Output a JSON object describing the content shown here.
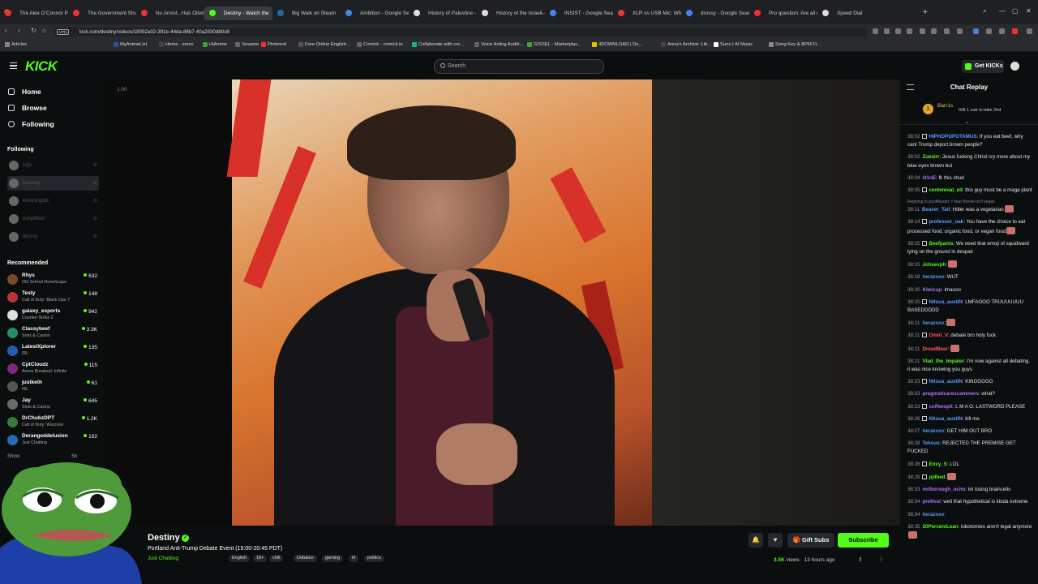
{
  "browser": {
    "tabs": [
      {
        "label": "The Alex O'Connor Podca",
        "color": "#e33"
      },
      {
        "label": "The Government Shutdo",
        "color": "#e33"
      },
      {
        "label": "No Arrest...Has Olivd Bee",
        "color": "#e33"
      },
      {
        "label": "Destiny - Watch the",
        "color": "#53fc18",
        "active": true
      },
      {
        "label": "Big Walk on Steam",
        "color": "#1b6bb3"
      },
      {
        "label": "Ambition - Google Search",
        "color": "#4285f4"
      },
      {
        "label": "History of Palestine - Wik",
        "color": "#ddd"
      },
      {
        "label": "History of the Israeli–Pale",
        "color": "#ddd"
      },
      {
        "label": "INSIST - Google Search",
        "color": "#4285f4"
      },
      {
        "label": "XLR vs USB Mic: Which Sh",
        "color": "#e33"
      },
      {
        "label": "drossy - Google Search",
        "color": "#4285f4"
      },
      {
        "label": "Pro question: Are all mic",
        "color": "#e33"
      },
      {
        "label": "Speed Dial",
        "color": "#ddd"
      }
    ],
    "url": "kick.com/destiny/videos/18092a02-391e-44da-88b7-40a2930d80c8",
    "vpn": "VPN",
    "bookmarks": [
      "Articles",
      "MyAnimeList",
      "Home - zmov",
      "HiAnime",
      "Sesame",
      "Pinterest",
      "Free Online English...",
      "Comick - comick.io",
      "Collaborate with cre...",
      "Voice Acting Auditi...",
      "GISSEL - Marketplac...",
      "4DOWNLOAD | Do...",
      "Anna's Archive: Lib...",
      "Suno | AI Music",
      "Song Key & BPM Fi..."
    ]
  },
  "header": {
    "logo": "KICK",
    "search_placeholder": "Search",
    "get_kicks": "Get KICKs"
  },
  "sidebar": {
    "nav": [
      "Home",
      "Browse",
      "Following"
    ],
    "following_title": "Following",
    "following": [
      "xQc",
      "Destiny",
      "esmongold",
      "Amplified",
      "feussy"
    ],
    "recommended_title": "Recommended",
    "recommended": [
      {
        "name": "Rhys",
        "category": "Old School RuneScape",
        "viewers": "632",
        "color": "#7a4b2a"
      },
      {
        "name": "Testy",
        "category": "Call of Duty: Black Ops 7",
        "viewers": "148",
        "color": "#b33"
      },
      {
        "name": "galaxy_esports",
        "category": "Counter-Strike 2",
        "viewers": "942",
        "color": "#ddd"
      },
      {
        "name": "Classybeef",
        "category": "Slots & Casino",
        "viewers": "3.3K",
        "color": "#2a8a6a"
      },
      {
        "name": "LatestXplorer",
        "category": "IRL",
        "viewers": "135",
        "color": "#2a5ab3"
      },
      {
        "name": "CptCloudz",
        "category": "Arena Breakout: Infinite",
        "viewers": "115",
        "color": "#7a2a7a"
      },
      {
        "name": "justketh",
        "category": "IRL",
        "viewers": "61",
        "color": "#555"
      },
      {
        "name": "Jay",
        "category": "Slots & Casino",
        "viewers": "645",
        "color": "#6a6a6a"
      },
      {
        "name": "DrChubzDPT",
        "category": "Call of Duty: Warzone",
        "viewers": "1.2K",
        "color": "#3a7a3a"
      },
      {
        "name": "Derangeddelusion",
        "category": "Just Chatting",
        "viewers": "102",
        "color": "#2a6ab3"
      }
    ],
    "show_more": "Show",
    "show_less": "Sh"
  },
  "video": {
    "timecode": "1.00"
  },
  "stream": {
    "channel": "Destiny",
    "title": "Portland Anti-Trump Debate Event (19:00-20:45 PDT)",
    "category": "Just Chatting",
    "tags": [
      "English",
      "18+",
      "chill",
      "Debates",
      "gaming",
      "irl",
      "politics"
    ],
    "views": "3.5K",
    "views_suffix": "views",
    "age": "13 hours ago",
    "gift_label": "Gift Subs",
    "subscribe_label": "Subscribe"
  },
  "chat": {
    "title": "Chat Replay",
    "pinned_rank": "1",
    "pinned_user": "Barr1s",
    "pinned_text": "Gift 1 sub to take 2nd",
    "messages": [
      {
        "ts": "38:02",
        "user": "HIPHOPOPOTAMUS",
        "color": "#5a9cff",
        "badge": true,
        "text": ": If you eat beef, why cant Trump deport brown people?"
      },
      {
        "ts": "38:02",
        "user": "Zuesirr",
        "color": "#53fc18",
        "text": ": Jesus fucking Christ cry more about my blue eyes brown boi"
      },
      {
        "ts": "38:04",
        "user": "l41nE",
        "color": "#b070ff",
        "text": ": fk this chud"
      },
      {
        "ts": "38:05",
        "user": "centennial_oil",
        "color": "#53fc18",
        "badge": true,
        "text": ": this guy must be a maga plant"
      },
      {
        "ts": "38:11",
        "user": "Beaver_Tail",
        "color": "#5a9cff",
        "reply": "Replying to puntMaster: I hear Bernie isn't vegan",
        "text": ": Hitler was a vegetarian",
        "emote": true
      },
      {
        "ts": "38:14",
        "user": "professor_oak",
        "color": "#5a9cff",
        "badge": true,
        "text": ": You have the choice to eat processed food, organic food, or vegan food",
        "emote": true
      },
      {
        "ts": "38:15",
        "user": "Beefpants",
        "color": "#53fc18",
        "badge": true,
        "text": ": We need that emoji of squidward lying on the ground in despair"
      },
      {
        "ts": "38:15",
        "user": "Johsevph",
        "color": "#53fc18",
        "text": ":",
        "emote": true
      },
      {
        "ts": "38:18",
        "user": "herazosv",
        "color": "#5a9cff",
        "text": ": WUT"
      },
      {
        "ts": "38:20",
        "user": "Kiwicup",
        "color": "#b070ff",
        "text": ": lmaooo"
      },
      {
        "ts": "38:20",
        "user": "Nitsua_austiN",
        "color": "#5a9cff",
        "badge": true,
        "text": ": LMFAOOO TRUUUUUUU BASEDDDDD"
      },
      {
        "ts": "38:21",
        "user": "herazosv",
        "color": "#5a9cff",
        "text": ":",
        "emote": true
      },
      {
        "ts": "38:21",
        "user": "Omni_V",
        "color": "#ff5a5a",
        "badge": true,
        "text": ": debate bro holy fuck"
      },
      {
        "ts": "38:21",
        "user": "DreadBear",
        "color": "#ff5a5a",
        "text": ":",
        "emote": true
      },
      {
        "ts": "38:21",
        "user": "Vlad_the_Impaler",
        "color": "#53fc18",
        "text": ": I'm now against all debating. it was nice knowing you guys"
      },
      {
        "ts": "38:23",
        "user": "Nitsua_austiN",
        "color": "#5a9cff",
        "badge": true,
        "text": ": KINGGGGG"
      },
      {
        "ts": "38:23",
        "user": "pragmaticarescammers",
        "color": "#b070ff",
        "text": ": what?"
      },
      {
        "ts": "38:23",
        "user": "coffeespit",
        "color": "#b070ff",
        "badge": true,
        "text": ": L M A O. LASTWORD PLEASE"
      },
      {
        "ts": "38:26",
        "user": "Nitsua_austiN",
        "color": "#5a9cff",
        "badge": true,
        "text": ": kill me"
      },
      {
        "ts": "38:27",
        "user": "herazosv",
        "color": "#5a9cff",
        "text": ": GET HIM OUT BRO"
      },
      {
        "ts": "38:28",
        "user": "Teksuo",
        "color": "#5a9cff",
        "text": ": REJECTED THE PREMISE GET FUCKED"
      },
      {
        "ts": "38:28",
        "user": "Envy_S",
        "color": "#53fc18",
        "badge": true,
        "text": ": LOL"
      },
      {
        "ts": "38:29",
        "user": "pj4hed",
        "color": "#53fc18",
        "badge": true,
        "text": ":",
        "emote": true
      },
      {
        "ts": "38:33",
        "user": "mrlborough_ocho",
        "color": "#b070ff",
        "text": ": im losing braincells"
      },
      {
        "ts": "38:34",
        "user": "prefixui",
        "color": "#b070ff",
        "text": ": well that hypothetical is kinda extreme"
      },
      {
        "ts": "38:34",
        "user": "herazosv",
        "color": "#5a9cff",
        "text": ":"
      },
      {
        "ts": "38:35",
        "user": "20PercentLean",
        "color": "#53fc18",
        "text": ": lobotomies aren't legal anymore",
        "emote": true
      }
    ]
  }
}
